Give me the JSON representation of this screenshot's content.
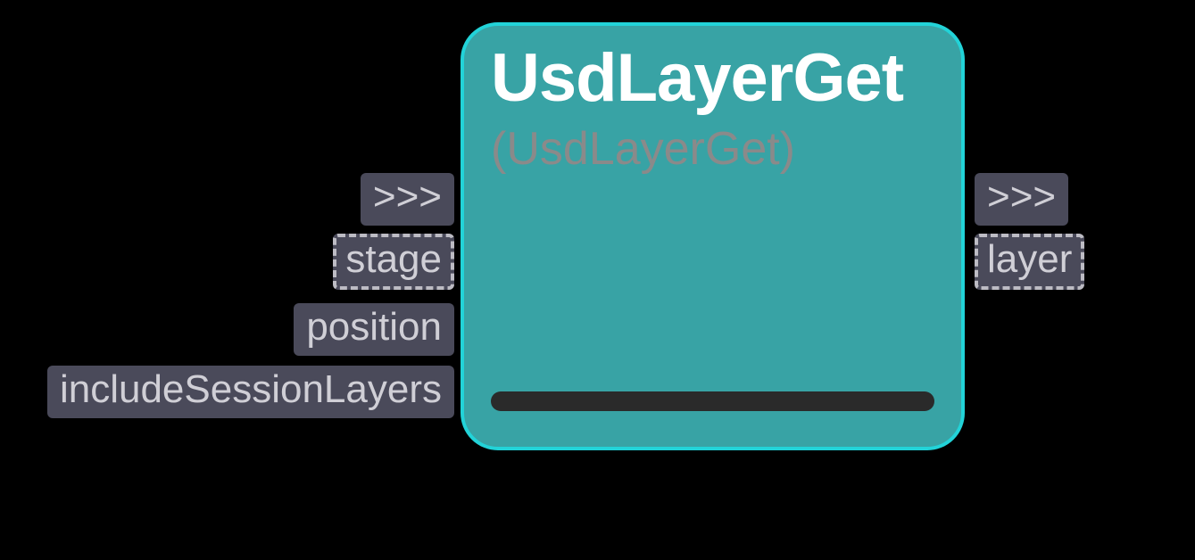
{
  "node": {
    "title": "UsdLayerGet",
    "subtitle": "(UsdLayerGet)"
  },
  "inputs": {
    "flow": ">>>",
    "stage": "stage",
    "position": "position",
    "includeSessionLayers": "includeSessionLayers"
  },
  "outputs": {
    "flow": ">>>",
    "layer": "layer"
  }
}
